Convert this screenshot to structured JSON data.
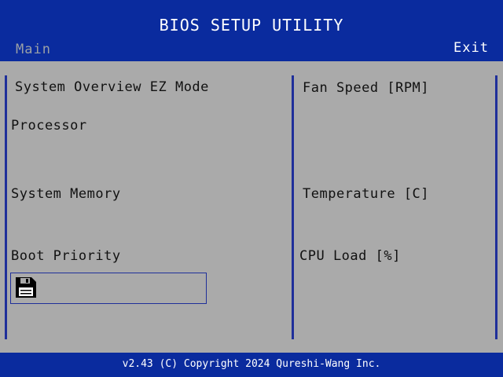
{
  "header": {
    "title": "BIOS SETUP UTILITY",
    "tabs": {
      "main": "Main",
      "exit": "Exit"
    }
  },
  "left_panel": {
    "overview_label": "System Overview EZ Mode",
    "processor_label": "Processor",
    "memory_label": "System Memory",
    "boot_label": "Boot Priority",
    "boot_device_icon": "floppy-disk-icon"
  },
  "right_panel": {
    "fan_label": "Fan Speed [RPM]",
    "temperature_label": "Temperature [C]",
    "cpu_load_label": "CPU Load [%]"
  },
  "footer": {
    "copyright": "v2.43 (C) Copyright 2024 Qureshi-Wang Inc."
  },
  "colors": {
    "bar_blue": "#0a2b9e",
    "panel_gray": "#aaaaaa",
    "divider_blue": "#1f2f9a",
    "inactive_tab": "#9aa0a6"
  }
}
